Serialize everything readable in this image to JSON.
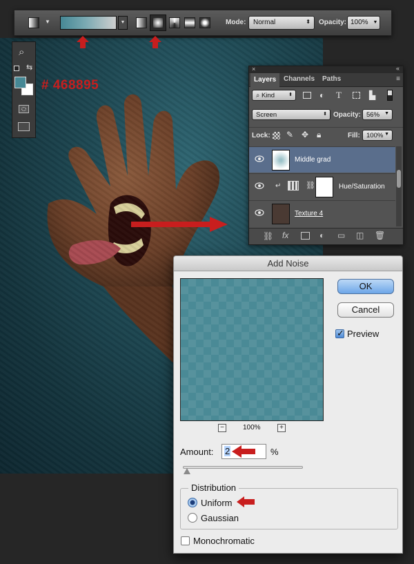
{
  "options_bar": {
    "mode_label": "Mode:",
    "mode_value": "Normal",
    "opacity_label": "Opacity:",
    "opacity_value": "100%",
    "gradient_styles": [
      "linear-gradient-icon",
      "radial-gradient-icon",
      "angle-gradient-icon",
      "reflected-gradient-icon",
      "diamond-gradient-icon"
    ],
    "selected_gradient_style": "radial-gradient-icon"
  },
  "annotation": {
    "hex_color": "# 468895",
    "color": "#c81e1e"
  },
  "tools": {
    "foreground_color": "#468895",
    "background_color": "#ffffff"
  },
  "layers_panel": {
    "tabs": [
      "Layers",
      "Channels",
      "Paths"
    ],
    "active_tab": "Layers",
    "filter_kind": "Kind",
    "blend_mode": "Screen",
    "opacity_label": "Opacity:",
    "opacity_value": "56%",
    "lock_label": "Lock:",
    "fill_label": "Fill:",
    "fill_value": "100%",
    "layers": [
      {
        "name": "Middle grad",
        "selected": true
      },
      {
        "name": "Hue/Saturation",
        "selected": false
      },
      {
        "name": "Texture 4",
        "selected": false
      }
    ]
  },
  "dialog": {
    "title": "Add Noise",
    "ok_label": "OK",
    "cancel_label": "Cancel",
    "preview_label": "Preview",
    "preview_checked": true,
    "zoom_value": "100%",
    "zoom_out": "−",
    "zoom_in": "+",
    "amount_label": "Amount:",
    "amount_value": "2",
    "amount_unit": "%",
    "distribution_label": "Distribution",
    "uniform_label": "Uniform",
    "gaussian_label": "Gaussian",
    "selected_distribution": "Uniform",
    "monochromatic_label": "Monochromatic",
    "monochromatic_checked": false,
    "preview_color": "#4a8a96"
  }
}
